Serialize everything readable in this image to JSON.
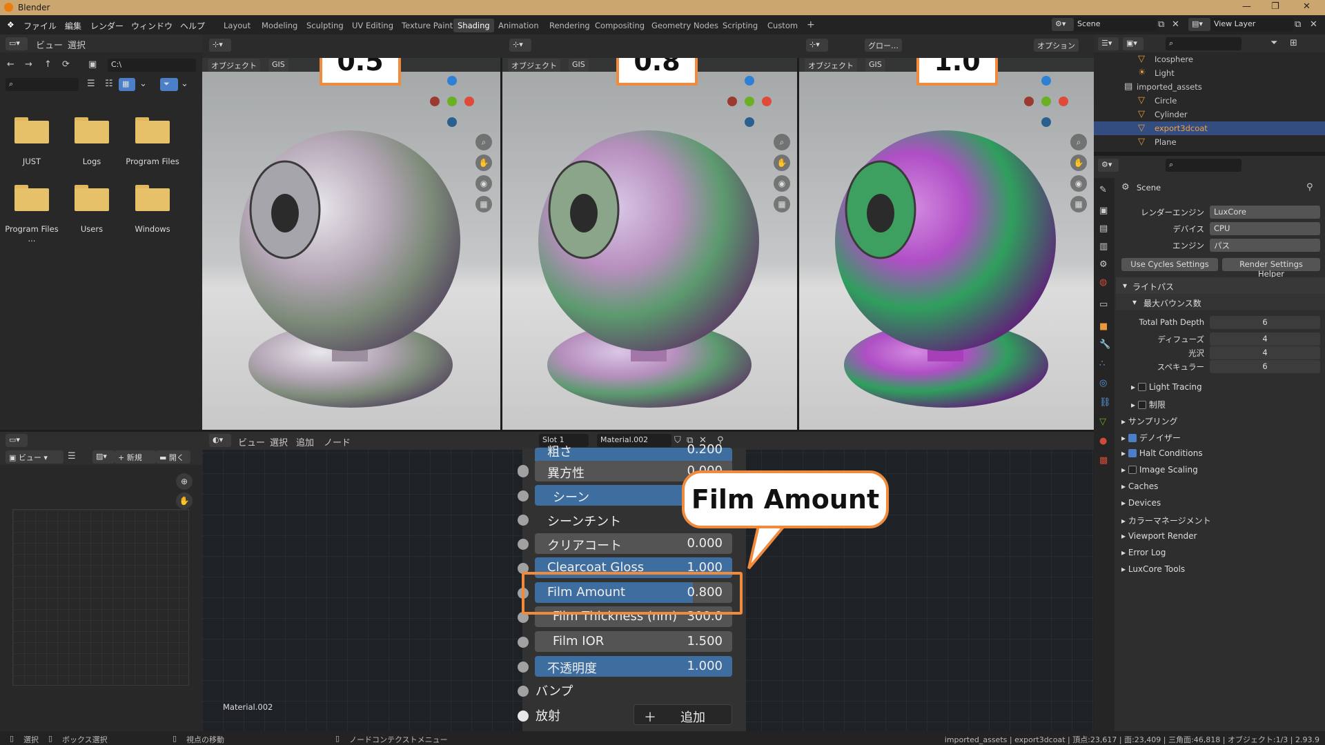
{
  "window": {
    "title": "Blender",
    "controls": [
      "—",
      "❐",
      "✕"
    ]
  },
  "menu": {
    "items": [
      "ファイル",
      "編集",
      "レンダー",
      "ウィンドウ",
      "ヘルプ"
    ]
  },
  "workspaces": [
    "Layout",
    "Modeling",
    "Sculpting",
    "UV Editing",
    "Texture Paint",
    "Shading",
    "Animation",
    "Rendering",
    "Compositing",
    "Geometry Nodes",
    "Scripting",
    "Custom",
    "+"
  ],
  "active_workspace": "Shading",
  "scene_selector": "Scene",
  "view_layer": "View Layer",
  "file_browser": {
    "header_items": [
      "ビュー",
      "選択"
    ],
    "path": "C:\\",
    "folders": [
      "JUST",
      "Logs",
      "Program Files",
      "Program Files ...",
      "Users",
      "Windows"
    ]
  },
  "image_editor": {
    "view_label": "ビュー",
    "new_label": "新規",
    "open_label": "開く"
  },
  "viewports": [
    {
      "mode": "オブジェクト",
      "gis": "GIS",
      "label": "0.5"
    },
    {
      "mode": "オブジェクト",
      "gis": "GIS",
      "label": "0.8"
    },
    {
      "mode": "オブジェクト",
      "gis": "GIS",
      "label": "1.0"
    }
  ],
  "viewport_extra": {
    "global": "グロー…",
    "options": "オプション"
  },
  "gizmo_axes": {
    "z": "Z",
    "x": "X"
  },
  "node_editor": {
    "header_items": [
      "ビュー",
      "選択",
      "追加",
      "ノード"
    ],
    "slot": "Slot 1",
    "material": "Material.002",
    "material_label": "Material.002",
    "rows": [
      {
        "label": "粗さ",
        "value": "0.200",
        "blue": true
      },
      {
        "label": "異方性",
        "value": "0.000",
        "blue": false
      },
      {
        "label": "シーン",
        "value": "",
        "blue": true
      },
      {
        "label": "シーンチント",
        "value": "",
        "blue": false
      },
      {
        "label": "クリアコート",
        "value": "0.000",
        "blue": false
      },
      {
        "label": "Clearcoat Gloss",
        "value": "1.000",
        "blue": true
      },
      {
        "label": "Film Amount",
        "value": "0.800",
        "blue": true
      },
      {
        "label": "Film Thickness (nm)",
        "value": "300.0",
        "blue": false
      },
      {
        "label": "Film IOR",
        "value": "1.500",
        "blue": false
      },
      {
        "label": "不透明度",
        "value": "1.000",
        "blue": true
      }
    ],
    "bump": "バンプ",
    "emission": "放射",
    "add_button": "追加",
    "callout": "Film Amount"
  },
  "outliner": {
    "items": [
      {
        "name": "Icosphere",
        "selected": false
      },
      {
        "name": "Light",
        "selected": false
      },
      {
        "name": "imported_assets",
        "selected": false
      },
      {
        "name": "Circle",
        "selected": false
      },
      {
        "name": "Cylinder",
        "selected": false
      },
      {
        "name": "export3dcoat",
        "selected": true
      },
      {
        "name": "Plane",
        "selected": false
      }
    ]
  },
  "properties": {
    "scene": "Scene",
    "render_engine_label": "レンダーエンジン",
    "render_engine": "LuxCore",
    "device_label": "デバイス",
    "device": "CPU",
    "engine_label": "エンジン",
    "engine": "パス",
    "use_cycles": "Use Cycles Settings",
    "render_helper": "Render Settings Helper",
    "light_path": "ライトパス",
    "max_bounces": "最大バウンス数",
    "total_path_depth_label": "Total Path Depth",
    "total_path_depth": "6",
    "diffuse_label": "ディフューズ",
    "diffuse": "4",
    "glossy_label": "光沢",
    "glossy": "4",
    "specular_label": "スペキュラー",
    "specular": "6",
    "light_tracing": "Light Tracing",
    "limit": "制限",
    "sections": [
      "サンプリング",
      "デノイザー",
      "Halt Conditions",
      "Image Scaling",
      "Caches",
      "Devices",
      "カラーマネージメント",
      "Viewport Render",
      "Error Log",
      "LuxCore Tools"
    ]
  },
  "statusbar": {
    "select": "選択",
    "box_select": "ボックス選択",
    "move_view": "視点の移動",
    "context_menu": "ノードコンテクストメニュー",
    "stats": "imported_assets | export3dcoat | 頂点:23,617 | 面:23,409 | 三角面:46,818 | オブジェクト:1/3 | 2.93.9"
  },
  "colors": {
    "accent_orange": "#f08a3c",
    "selected_blue": "#334d80",
    "field_blue": "#3e6ea0"
  }
}
